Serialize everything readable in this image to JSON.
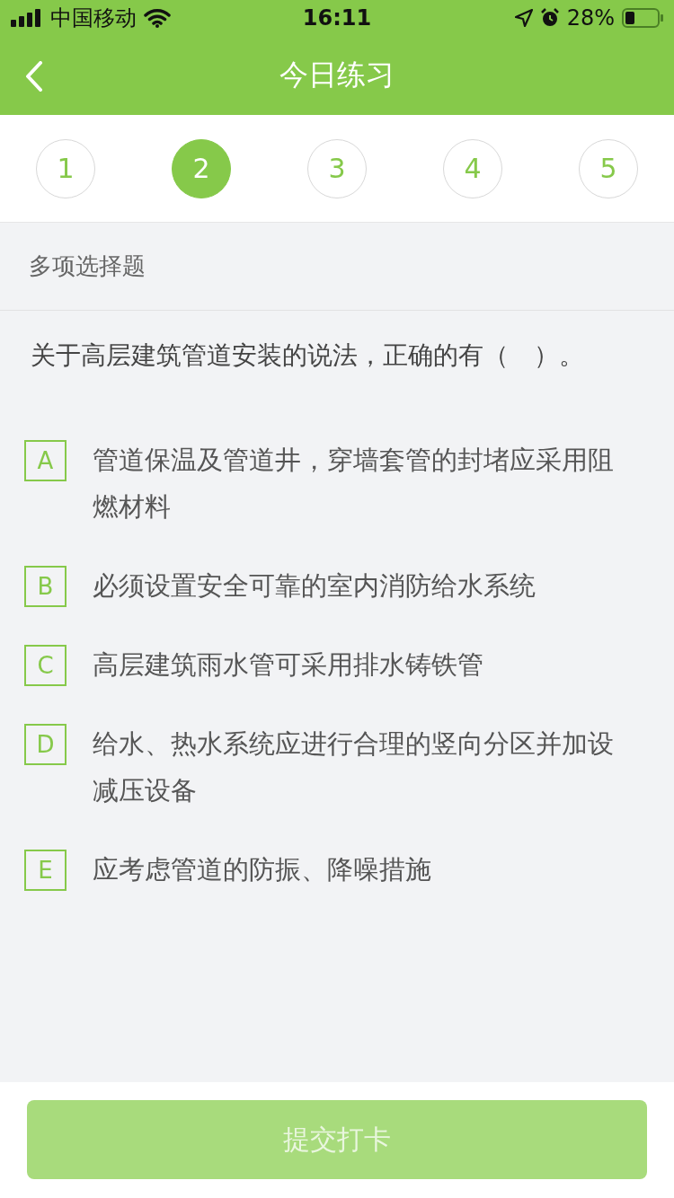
{
  "status_bar": {
    "carrier": "中国移动",
    "time": "16:11",
    "battery": "28%"
  },
  "nav": {
    "title": "今日练习"
  },
  "steps": [
    {
      "label": "1",
      "selected": false
    },
    {
      "label": "2",
      "selected": true
    },
    {
      "label": "3",
      "selected": false
    },
    {
      "label": "4",
      "selected": false
    },
    {
      "label": "5",
      "selected": false
    }
  ],
  "question_type": "多项选择题",
  "question": "关于高层建筑管道安装的说法，正确的有（　）。",
  "options": [
    {
      "letter": "A",
      "text": "管道保温及管道井，穿墙套管的封堵应采用阻燃材料",
      "selected": false
    },
    {
      "letter": "B",
      "text": "必须设置安全可靠的室内消防给水系统",
      "selected": false
    },
    {
      "letter": "C",
      "text": "高层建筑雨水管可采用排水铸铁管",
      "selected": false
    },
    {
      "letter": "D",
      "text": "给水、热水系统应进行合理的竖向分区并加设减压设备",
      "selected": false
    },
    {
      "letter": "E",
      "text": "应考虑管道的防振、降噪措施",
      "selected": false
    }
  ],
  "submit": {
    "label": "提交打卡",
    "disabled": true
  }
}
